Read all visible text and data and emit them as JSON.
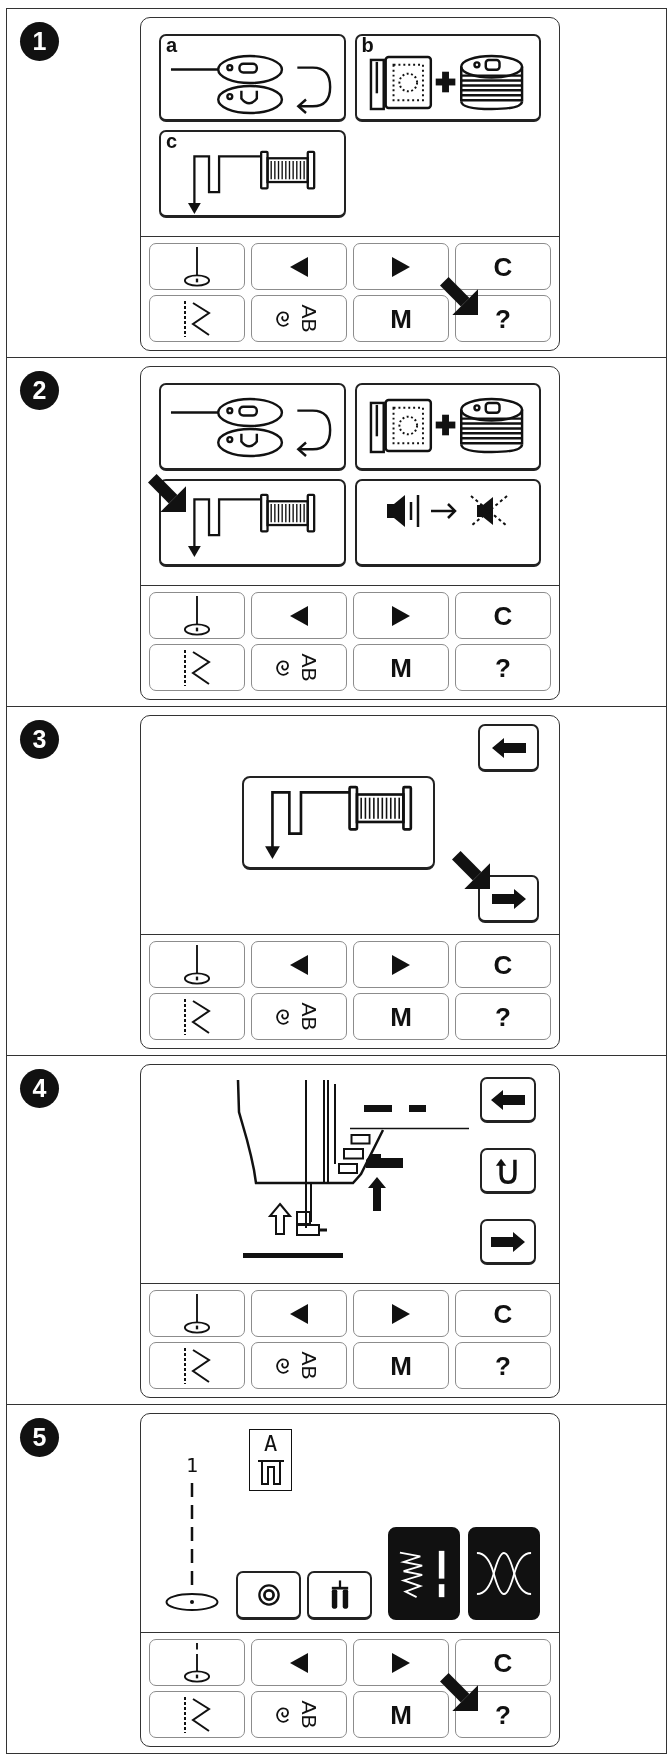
{
  "steps": [
    {
      "number": "1",
      "screen": {
        "kind": "menu",
        "tiles": [
          {
            "label": "a",
            "kind": "bobbin_winding",
            "pointer": false
          },
          {
            "label": "b",
            "kind": "bobbin_case",
            "pointer": false
          },
          {
            "label": "c",
            "kind": "threading",
            "pointer": false
          }
        ]
      },
      "keys": [
        {
          "kind": "needle",
          "pointer": false
        },
        {
          "kind": "left",
          "pointer": false
        },
        {
          "kind": "right",
          "pointer": false
        },
        {
          "kind": "letter",
          "label": "C",
          "pointer": false
        },
        {
          "kind": "stitch",
          "pointer": false
        },
        {
          "kind": "ab",
          "label": "AB",
          "pointer": false
        },
        {
          "kind": "letter",
          "label": "M",
          "pointer": false
        },
        {
          "kind": "letter",
          "label": "?",
          "pointer": true
        }
      ]
    },
    {
      "number": "2",
      "screen": {
        "kind": "menu",
        "tiles": [
          {
            "kind": "bobbin_winding",
            "pointer": false
          },
          {
            "kind": "bobbin_case",
            "pointer": false
          },
          {
            "kind": "threading",
            "pointer": true
          },
          {
            "kind": "mute",
            "pointer": false
          }
        ]
      },
      "keys": [
        {
          "kind": "needle",
          "pointer": false
        },
        {
          "kind": "left",
          "pointer": false
        },
        {
          "kind": "right",
          "pointer": false
        },
        {
          "kind": "letter",
          "label": "C",
          "pointer": false
        },
        {
          "kind": "stitch",
          "pointer": false
        },
        {
          "kind": "ab",
          "label": "AB",
          "pointer": false
        },
        {
          "kind": "letter",
          "label": "M",
          "pointer": false
        },
        {
          "kind": "letter",
          "label": "?",
          "pointer": false
        }
      ]
    },
    {
      "number": "3",
      "screen": {
        "kind": "confirm",
        "tile": {
          "kind": "threading",
          "pointer": false
        },
        "buttons": [
          {
            "kind": "back",
            "pointer": false
          },
          {
            "kind": "forward",
            "pointer": true
          }
        ]
      },
      "keys": [
        {
          "kind": "needle",
          "pointer": false
        },
        {
          "kind": "left",
          "pointer": false
        },
        {
          "kind": "right",
          "pointer": false
        },
        {
          "kind": "letter",
          "label": "C",
          "pointer": false
        },
        {
          "kind": "stitch",
          "pointer": false
        },
        {
          "kind": "ab",
          "label": "AB",
          "pointer": false
        },
        {
          "kind": "letter",
          "label": "M",
          "pointer": false
        },
        {
          "kind": "letter",
          "label": "?",
          "pointer": false
        }
      ]
    },
    {
      "number": "4",
      "screen": {
        "kind": "machine",
        "buttons": [
          {
            "kind": "back",
            "pointer": false
          },
          {
            "kind": "rotate",
            "pointer": false
          },
          {
            "kind": "forward",
            "pointer": false
          }
        ]
      },
      "keys": [
        {
          "kind": "needle",
          "pointer": false
        },
        {
          "kind": "left",
          "pointer": false
        },
        {
          "kind": "right",
          "pointer": false
        },
        {
          "kind": "letter",
          "label": "C",
          "pointer": false
        },
        {
          "kind": "stitch",
          "pointer": false
        },
        {
          "kind": "ab",
          "label": "AB",
          "pointer": false
        },
        {
          "kind": "letter",
          "label": "M",
          "pointer": false
        },
        {
          "kind": "letter",
          "label": "?",
          "pointer": false
        }
      ]
    },
    {
      "number": "5",
      "screen": {
        "kind": "stitch",
        "number_label": "1",
        "foot_letter": "A",
        "buttons": [
          {
            "kind": "target"
          },
          {
            "kind": "twin_needle"
          }
        ],
        "stitch_tiles": [
          {
            "kind": "zigzag",
            "selected": true
          },
          {
            "kind": "cross",
            "selected": true
          }
        ]
      },
      "keys": [
        {
          "kind": "needle_split",
          "pointer": false
        },
        {
          "kind": "left",
          "pointer": false
        },
        {
          "kind": "right",
          "pointer": false
        },
        {
          "kind": "letter",
          "label": "C",
          "pointer": false
        },
        {
          "kind": "stitch",
          "pointer": false
        },
        {
          "kind": "ab",
          "label": "AB",
          "pointer": false
        },
        {
          "kind": "letter",
          "label": "M",
          "pointer": false
        },
        {
          "kind": "letter",
          "label": "?",
          "pointer": true
        }
      ]
    }
  ]
}
